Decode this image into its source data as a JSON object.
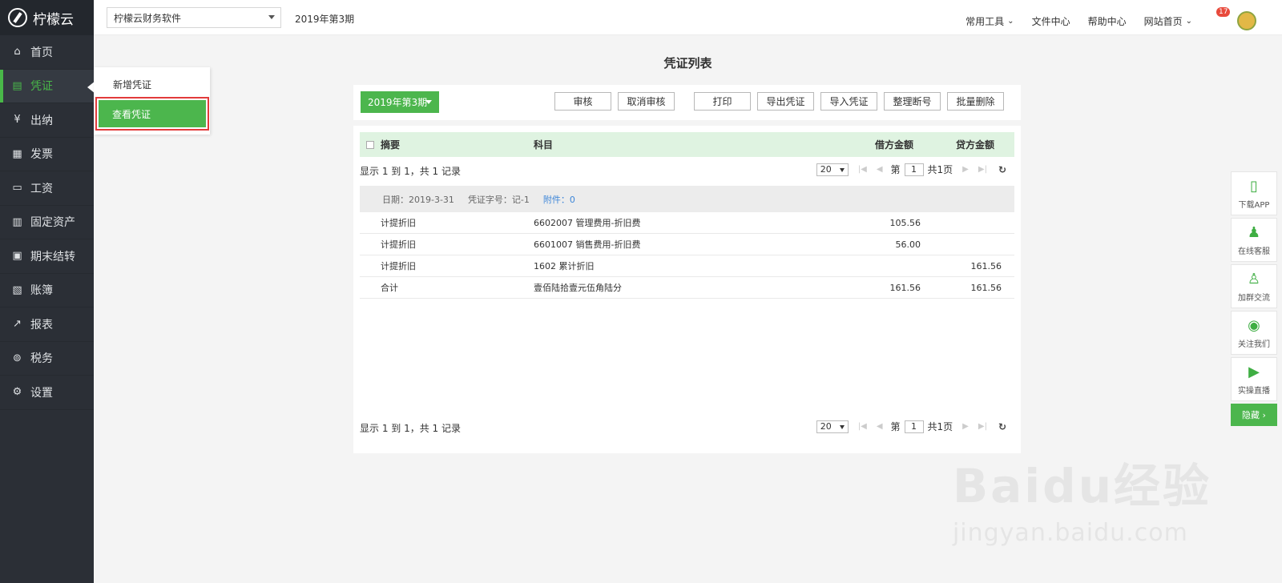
{
  "brand": {
    "name": "柠檬云"
  },
  "sidebar": {
    "items": [
      {
        "label": "首页",
        "icon": "⌂"
      },
      {
        "label": "凭证",
        "icon": "▤"
      },
      {
        "label": "出纳",
        "icon": "¥"
      },
      {
        "label": "发票",
        "icon": "▦"
      },
      {
        "label": "工资",
        "icon": "▭"
      },
      {
        "label": "固定资产",
        "icon": "▥"
      },
      {
        "label": "期末结转",
        "icon": "▣"
      },
      {
        "label": "账簿",
        "icon": "▧"
      },
      {
        "label": "报表",
        "icon": "↗"
      },
      {
        "label": "税务",
        "icon": "⊚"
      },
      {
        "label": "设置",
        "icon": "⚙"
      }
    ],
    "active_index": 1
  },
  "submenu": {
    "items": [
      "新增凭证",
      "查看凭证"
    ]
  },
  "topbar": {
    "company": "柠檬云财务软件",
    "period": "2019年第3期",
    "links": [
      "常用工具",
      "文件中心",
      "帮助中心",
      "网站首页"
    ],
    "notification_count": "17"
  },
  "page": {
    "title": "凭证列表"
  },
  "toolbar": {
    "period_button": "2019年第3期",
    "buttons": [
      "审核",
      "取消审核",
      "打印",
      "导出凭证",
      "导入凭证",
      "整理断号",
      "批量删除"
    ]
  },
  "table": {
    "headers": {
      "summary": "摘要",
      "account": "科目",
      "debit": "借方金额",
      "credit": "贷方金额"
    },
    "records_info": "显示 1 到 1，共 1 记录",
    "page_size": "20",
    "page_prefix": "第",
    "current_page": "1",
    "total_pages": "共1页",
    "voucher": {
      "date": "日期：2019-3-31",
      "number": "凭证字号：记-1",
      "attachments": "附件：0"
    },
    "rows": [
      {
        "summary": "计提折旧",
        "account": "6602007 管理费用-折旧费",
        "debit": "105.56",
        "credit": ""
      },
      {
        "summary": "计提折旧",
        "account": "6601007 销售费用-折旧费",
        "debit": "56.00",
        "credit": ""
      },
      {
        "summary": "计提折旧",
        "account": "1602 累计折旧",
        "debit": "",
        "credit": "161.56"
      },
      {
        "summary": "合计",
        "account": "壹佰陆拾壹元伍角陆分",
        "debit": "161.56",
        "credit": "161.56"
      }
    ]
  },
  "float_tools": {
    "items": [
      {
        "label": "下载APP",
        "icon": "▯"
      },
      {
        "label": "在线客服",
        "icon": "♟"
      },
      {
        "label": "加群交流",
        "icon": "♙"
      },
      {
        "label": "关注我们",
        "icon": "◉"
      },
      {
        "label": "实操直播",
        "icon": "▶"
      }
    ],
    "hide": "隐藏 ›"
  },
  "watermark": {
    "line1": "Baidu经验",
    "line2": "jingyan.baidu.com"
  },
  "colors": {
    "accent": "#4cb64d",
    "sidebar": "#2b2f36",
    "link": "#3c85d8",
    "highlight": "#e23b3b"
  }
}
